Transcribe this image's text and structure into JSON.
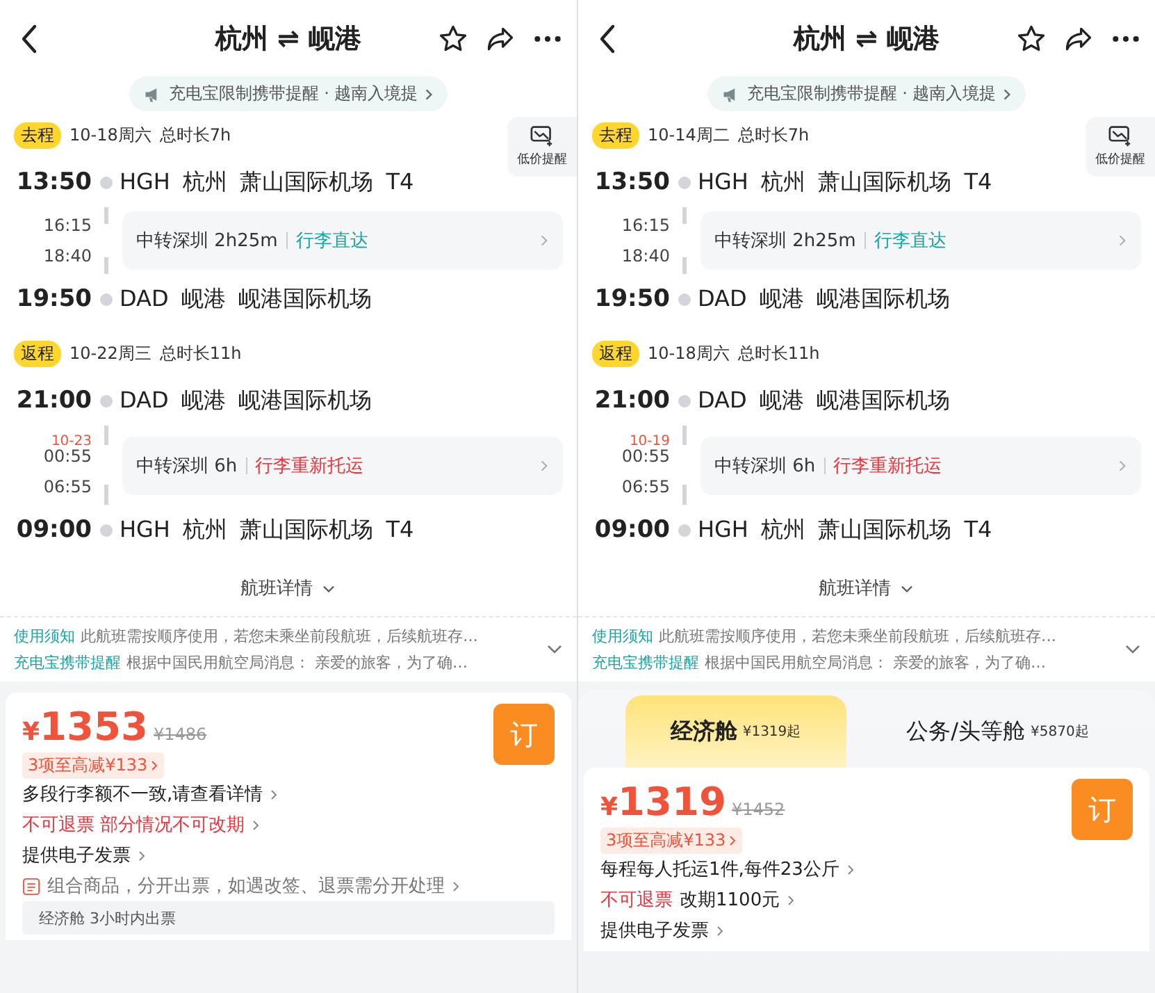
{
  "panels": [
    {
      "header": {
        "title": "杭州 ⇌ 岘港"
      },
      "notice": "充电宝限制携带提醒 · 越南入境提",
      "price_alert": "低价提醒",
      "legs": [
        {
          "label": "去程",
          "date": "10-18周六",
          "duration": "总时长7h",
          "depart_time": "13:50",
          "depart_airport": "HGH 杭州 萧山国际机场 T4",
          "transfer_arrive": "16:15",
          "transfer_depart": "18:40",
          "transfer": "中转深圳 2h25m",
          "baggage": "行李直达",
          "recheck": false,
          "arrive_time": "19:50",
          "arrive_airport": "DAD 岘港 岘港国际机场"
        },
        {
          "label": "返程",
          "date": "10-22周三",
          "duration": "总时长11h",
          "depart_time": "21:00",
          "depart_airport": "DAD 岘港 岘港国际机场",
          "transfer_date": "10-23",
          "transfer_arrive": "00:55",
          "transfer_depart": "06:55",
          "transfer": "中转深圳 6h",
          "baggage": "行李重新托运",
          "recheck": true,
          "arrive_time": "09:00",
          "arrive_airport": "HGH 杭州 萧山国际机场 T4"
        }
      ],
      "details_link": "航班详情",
      "notes": [
        {
          "label": "使用须知",
          "text": "此航班需按顺序使用，若您未乘坐前段航班，后续航班存…"
        },
        {
          "label": "充电宝携带提醒",
          "text": "根据中国民用航空局消息： 亲爱的旅客，为了确…"
        }
      ],
      "fare": {
        "currency": "¥",
        "price": "1353",
        "original": "¥1486",
        "discount": "3项至高减¥133",
        "book": "订",
        "lines": [
          {
            "kind": "link",
            "segments": [
              {
                "text": "多段行李额不一致,请查看详情",
                "alert": false
              }
            ]
          },
          {
            "kind": "link",
            "segments": [
              {
                "text": "不可退票 部分情况不可改期",
                "alert": true
              }
            ]
          },
          {
            "kind": "link",
            "segments": [
              {
                "text": "提供电子发票",
                "alert": false
              }
            ]
          },
          {
            "kind": "combo",
            "segments": [
              {
                "text": "组合商品，分开出票，如遇改签、退票需分开处理",
                "alert": false
              }
            ]
          },
          {
            "kind": "tag",
            "segments": [
              {
                "text": "经济舱 3小时内出票",
                "alert": false
              }
            ]
          }
        ]
      }
    },
    {
      "header": {
        "title": "杭州 ⇌ 岘港"
      },
      "notice": "充电宝限制携带提醒 · 越南入境提",
      "price_alert": "低价提醒",
      "legs": [
        {
          "label": "去程",
          "date": "10-14周二",
          "duration": "总时长7h",
          "depart_time": "13:50",
          "depart_airport": "HGH 杭州 萧山国际机场 T4",
          "transfer_arrive": "16:15",
          "transfer_depart": "18:40",
          "transfer": "中转深圳 2h25m",
          "baggage": "行李直达",
          "recheck": false,
          "arrive_time": "19:50",
          "arrive_airport": "DAD 岘港 岘港国际机场"
        },
        {
          "label": "返程",
          "date": "10-18周六",
          "duration": "总时长11h",
          "depart_time": "21:00",
          "depart_airport": "DAD 岘港 岘港国际机场",
          "transfer_date": "10-19",
          "transfer_arrive": "00:55",
          "transfer_depart": "06:55",
          "transfer": "中转深圳 6h",
          "baggage": "行李重新托运",
          "recheck": true,
          "arrive_time": "09:00",
          "arrive_airport": "HGH 杭州 萧山国际机场 T4"
        }
      ],
      "details_link": "航班详情",
      "notes": [
        {
          "label": "使用须知",
          "text": "此航班需按顺序使用，若您未乘坐前段航班，后续航班存…"
        },
        {
          "label": "充电宝携带提醒",
          "text": "根据中国民用航空局消息： 亲爱的旅客，为了确…"
        }
      ],
      "cabin_tabs": [
        {
          "name": "经济舱",
          "price": "¥1319起",
          "selected": true
        },
        {
          "name": "公务/头等舱",
          "price": "¥5870起",
          "selected": false
        }
      ],
      "fare": {
        "currency": "¥",
        "price": "1319",
        "original": "¥1452",
        "discount": "3项至高减¥133",
        "book": "订",
        "lines": [
          {
            "kind": "link",
            "segments": [
              {
                "text": "每程每人托运1件,每件23公斤",
                "alert": false
              }
            ]
          },
          {
            "kind": "link",
            "segments": [
              {
                "text": "不可退票",
                "alert": true
              },
              {
                "text": "改期1100元",
                "alert": false
              }
            ]
          },
          {
            "kind": "link",
            "segments": [
              {
                "text": "提供电子发票",
                "alert": false
              }
            ]
          }
        ]
      }
    }
  ]
}
